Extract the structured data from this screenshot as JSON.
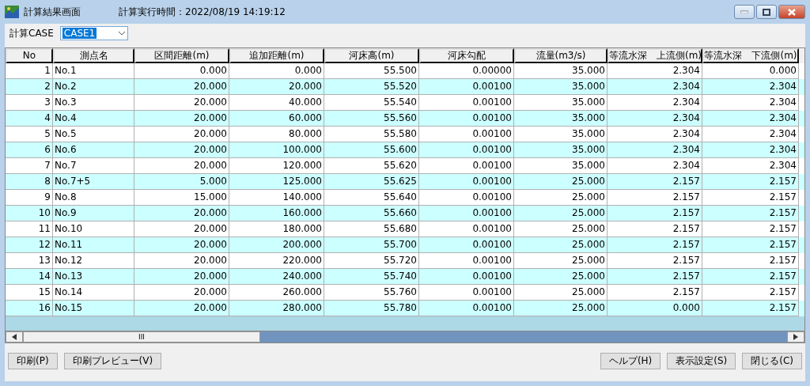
{
  "window": {
    "title": "計算結果画面",
    "run_time": "計算実行時間：2022/08/19 14:19:12"
  },
  "case_selector": {
    "label": "計算CASE",
    "value": "CASE1"
  },
  "table": {
    "columns": [
      "No",
      "測点名",
      "区間距離(m)",
      "追加距離(m)",
      "河床高(m)",
      "河床勾配",
      "流量(m3/s)",
      "等流水深　上流側(m)",
      "等流水深　下流側(m)"
    ],
    "rows": [
      [
        "1",
        "No.1",
        "0.000",
        "0.000",
        "55.500",
        "0.00000",
        "35.000",
        "2.304",
        "0.000"
      ],
      [
        "2",
        "No.2",
        "20.000",
        "20.000",
        "55.520",
        "0.00100",
        "35.000",
        "2.304",
        "2.304"
      ],
      [
        "3",
        "No.3",
        "20.000",
        "40.000",
        "55.540",
        "0.00100",
        "35.000",
        "2.304",
        "2.304"
      ],
      [
        "4",
        "No.4",
        "20.000",
        "60.000",
        "55.560",
        "0.00100",
        "35.000",
        "2.304",
        "2.304"
      ],
      [
        "5",
        "No.5",
        "20.000",
        "80.000",
        "55.580",
        "0.00100",
        "35.000",
        "2.304",
        "2.304"
      ],
      [
        "6",
        "No.6",
        "20.000",
        "100.000",
        "55.600",
        "0.00100",
        "35.000",
        "2.304",
        "2.304"
      ],
      [
        "7",
        "No.7",
        "20.000",
        "120.000",
        "55.620",
        "0.00100",
        "35.000",
        "2.304",
        "2.304"
      ],
      [
        "8",
        "No.7+5",
        "5.000",
        "125.000",
        "55.625",
        "0.00100",
        "25.000",
        "2.157",
        "2.157"
      ],
      [
        "9",
        "No.8",
        "15.000",
        "140.000",
        "55.640",
        "0.00100",
        "25.000",
        "2.157",
        "2.157"
      ],
      [
        "10",
        "No.9",
        "20.000",
        "160.000",
        "55.660",
        "0.00100",
        "25.000",
        "2.157",
        "2.157"
      ],
      [
        "11",
        "No.10",
        "20.000",
        "180.000",
        "55.680",
        "0.00100",
        "25.000",
        "2.157",
        "2.157"
      ],
      [
        "12",
        "No.11",
        "20.000",
        "200.000",
        "55.700",
        "0.00100",
        "25.000",
        "2.157",
        "2.157"
      ],
      [
        "13",
        "No.12",
        "20.000",
        "220.000",
        "55.720",
        "0.00100",
        "25.000",
        "2.157",
        "2.157"
      ],
      [
        "14",
        "No.13",
        "20.000",
        "240.000",
        "55.740",
        "0.00100",
        "25.000",
        "2.157",
        "2.157"
      ],
      [
        "15",
        "No.14",
        "20.000",
        "260.000",
        "55.760",
        "0.00100",
        "25.000",
        "2.157",
        "2.157"
      ],
      [
        "16",
        "No.15",
        "20.000",
        "280.000",
        "55.780",
        "0.00100",
        "25.000",
        "0.000",
        "2.157"
      ]
    ]
  },
  "scrollbar_grip": "III",
  "buttons_left": [
    "印刷(P)",
    "印刷プレビュー(V)"
  ],
  "buttons_right": [
    "ヘルプ(H)",
    "表示設定(S)",
    "閉じる(C)"
  ]
}
